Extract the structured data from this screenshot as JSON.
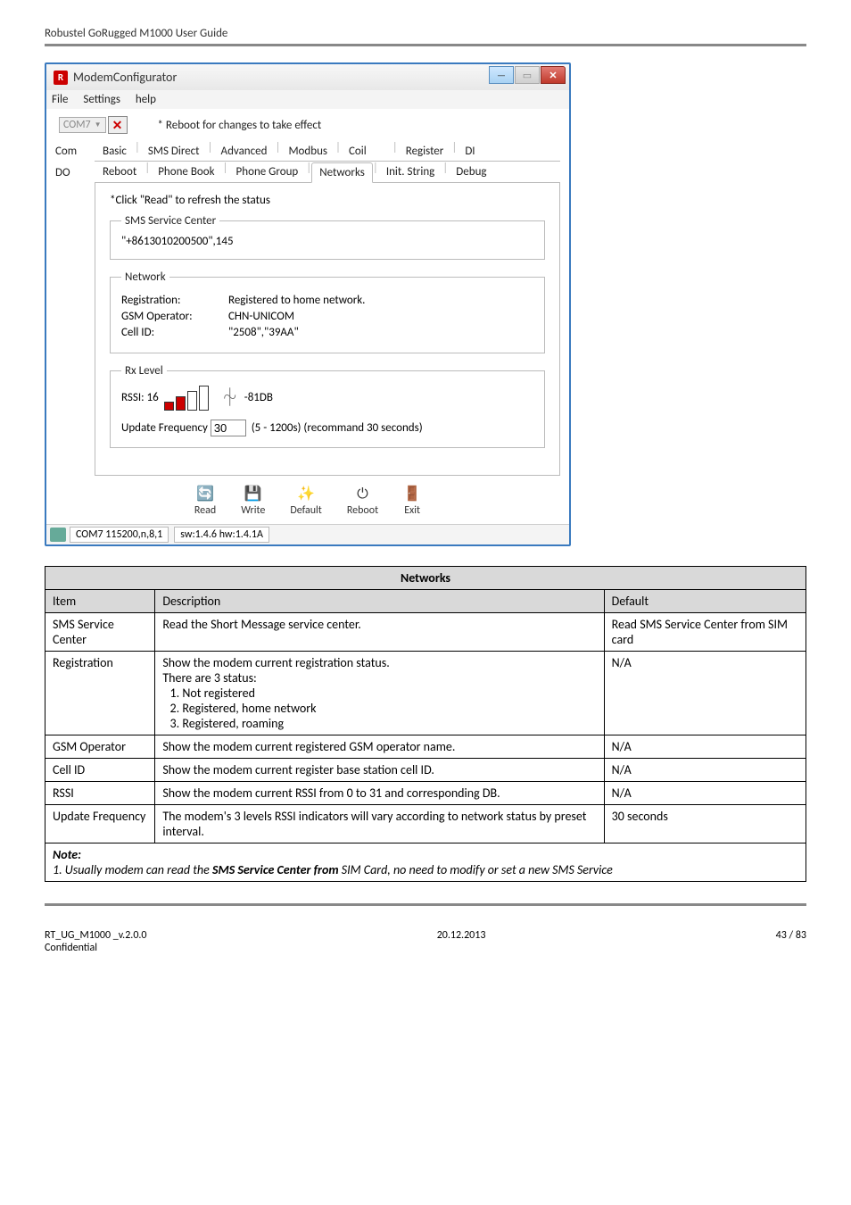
{
  "page_header": "Robustel GoRugged M1000 User Guide",
  "window": {
    "title": "ModemConfigurator",
    "menu": {
      "file": "File",
      "settings": "Settings",
      "help": "help"
    },
    "port": "COM7",
    "close_x": "✕",
    "reboot_note": "* Reboot for changes to take effect",
    "left_labels": {
      "com": "Com",
      "do": "DO"
    },
    "tabs_top": [
      "Basic",
      "SMS Direct",
      "Advanced",
      "Modbus",
      "Coil",
      "Register",
      "DI"
    ],
    "tabs_bottom": [
      "Reboot",
      "Phone Book",
      "Phone Group",
      "Networks",
      "Init. String",
      "Debug"
    ],
    "active_tab": "Networks",
    "refresh_note": "*Click \"Read\" to refresh the status",
    "sms_center": {
      "legend": "SMS Service Center",
      "value": "\"+8613010200500\",145"
    },
    "network": {
      "legend": "Network",
      "registration": {
        "label": "Registration:",
        "value": "Registered to home network."
      },
      "gsm_operator": {
        "label": "GSM Operator:",
        "value": "CHN-UNICOM"
      },
      "cell_id": {
        "label": "Cell ID:",
        "value": "\"2508\",\"39AA\""
      }
    },
    "rx_level": {
      "legend": "Rx Level",
      "rssi_label": "RSSI: 16",
      "rssi_db": "-81DB",
      "freq_label": "Update Frequency",
      "freq_value": "30",
      "freq_hint": "(5 - 1200s) (recommand 30 seconds)"
    },
    "buttons": {
      "read": "Read",
      "write": "Write",
      "default": "Default",
      "reboot": "Reboot",
      "exit": "Exit"
    },
    "status": {
      "port": "COM7 115200,n,8,1",
      "sw": "sw:1.4.6 hw:1.4.1A"
    }
  },
  "table": {
    "title": "Networks",
    "head": {
      "item": "Item",
      "desc": "Description",
      "def": "Default"
    },
    "rows": {
      "sms_center": {
        "item": "SMS Service Center",
        "desc": "Read the Short Message service center.",
        "def": "Read SMS Service Center from SIM card"
      },
      "registration": {
        "item": "Registration",
        "desc_intro1": "Show the modem current registration status.",
        "desc_intro2": "There are 3 status:",
        "statuses": [
          "Not registered",
          "Registered, home network",
          "Registered, roaming"
        ],
        "def": "N/A"
      },
      "gsm": {
        "item": "GSM Operator",
        "desc": "Show the modem current registered GSM operator name.",
        "def": "N/A"
      },
      "cell": {
        "item": "Cell ID",
        "desc": "Show the modem current register base station cell ID.",
        "def": "N/A"
      },
      "rssi": {
        "item": "RSSI",
        "desc": "Show the modem current RSSI from 0 to 31 and corresponding DB.",
        "def": "N/A"
      },
      "freq": {
        "item": "Update Frequency",
        "desc": "The modem's 3 levels RSSI indicators will vary according to network status by preset interval.",
        "def": "30 seconds"
      }
    },
    "note_label": "Note:",
    "note_prefix": "1.  Usually modem can read the ",
    "note_bold": "SMS Service Center from",
    "note_suffix": " SIM Card, no need to modify or set a new SMS Service"
  },
  "footer": {
    "left1": "RT_UG_M1000 _v.2.0.0",
    "left2": "Confidential",
    "center": "20.12.2013",
    "right": "43 / 83"
  }
}
